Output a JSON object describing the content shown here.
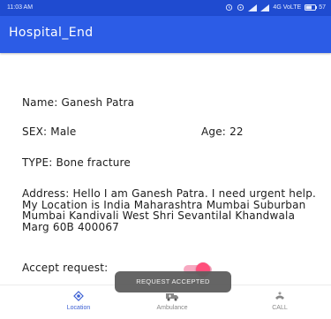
{
  "status_bar": {
    "time": "11:03 AM",
    "network_label": "4G VoLTE",
    "battery_percent": "57"
  },
  "app_bar": {
    "title": "Hospital_End"
  },
  "request": {
    "name": "Name: Ganesh Patra",
    "sex": "SEX: Male",
    "age": "Age: 22",
    "type": "TYPE: Bone fracture",
    "address": "Address: Hello I am Ganesh Patra. I need urgent help. My Location is India Maharashtra Mumbai Suburban Mumbai Kandivali West Shri Sevantilal Khandwala Marg 60B 400067",
    "accept_label": "Accept request:",
    "accept_on": true
  },
  "colors": {
    "status_bar": "#1f4bd0",
    "app_bar": "#2c5ce6",
    "switch_thumb": "#ff4f7b",
    "switch_track": "#f7a9c1",
    "active_nav": "#3b5fd3"
  },
  "toast": {
    "message": "REQUEST ACCEPTED"
  },
  "bottom_nav": {
    "items": [
      {
        "label": "Location",
        "icon": "location-icon",
        "active": true
      },
      {
        "label": "Ambulance",
        "icon": "ambulance-icon",
        "active": false
      },
      {
        "label": "CALL",
        "icon": "call-icon",
        "active": false
      }
    ]
  }
}
